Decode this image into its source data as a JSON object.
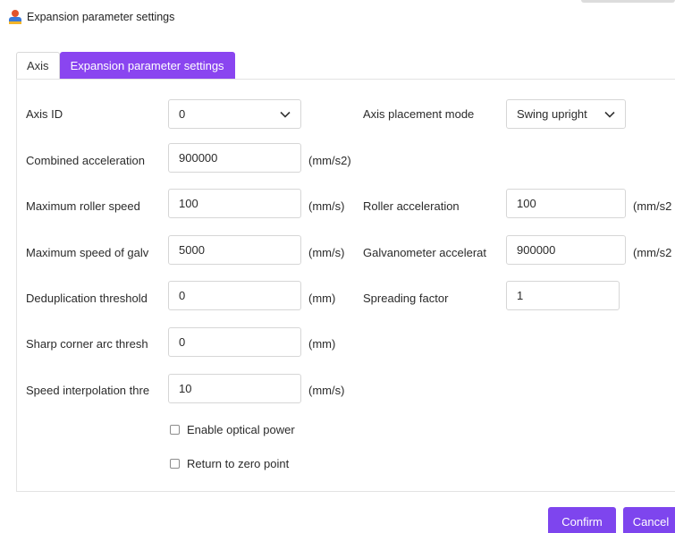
{
  "window": {
    "title": "Expansion parameter settings"
  },
  "tabs": [
    {
      "label": "Axis"
    },
    {
      "label": "Expansion parameter settings"
    }
  ],
  "fields": {
    "axis_id": {
      "label": "Axis ID",
      "value": "0"
    },
    "axis_placement_mode": {
      "label": "Axis placement mode",
      "value": "Swing upright"
    },
    "combined_acceleration": {
      "label": "Combined acceleration",
      "value": "900000",
      "unit": "(mm/s2)"
    },
    "max_roller_speed": {
      "label": "Maximum roller speed",
      "value": "100",
      "unit": "(mm/s)"
    },
    "roller_acceleration": {
      "label": "Roller acceleration",
      "value": "100",
      "unit": "(mm/s2"
    },
    "max_speed_galv": {
      "label": "Maximum speed of galv",
      "value": "5000",
      "unit": "(mm/s)"
    },
    "galv_acceleration": {
      "label": "Galvanometer accelerat",
      "value": "900000",
      "unit": "(mm/s2"
    },
    "dedup_threshold": {
      "label": "Deduplication threshold",
      "value": "0",
      "unit": "(mm)"
    },
    "spreading_factor": {
      "label": "Spreading factor",
      "value": "1"
    },
    "sharp_corner": {
      "label": "Sharp corner arc thresh",
      "value": "0",
      "unit": "(mm)"
    },
    "speed_interp": {
      "label": "Speed interpolation thre",
      "value": "10",
      "unit": "(mm/s)"
    }
  },
  "checkboxes": {
    "enable_optical_power": {
      "label": "Enable optical power"
    },
    "return_to_zero": {
      "label": "Return to zero point"
    }
  },
  "buttons": {
    "confirm": "Confirm",
    "cancel": "Cancel"
  },
  "icons": {
    "app": "app-icon",
    "chevron": "chevron-down-icon"
  },
  "colors": {
    "accent": "#7e45ee",
    "tab_active": "#8a45f0"
  }
}
